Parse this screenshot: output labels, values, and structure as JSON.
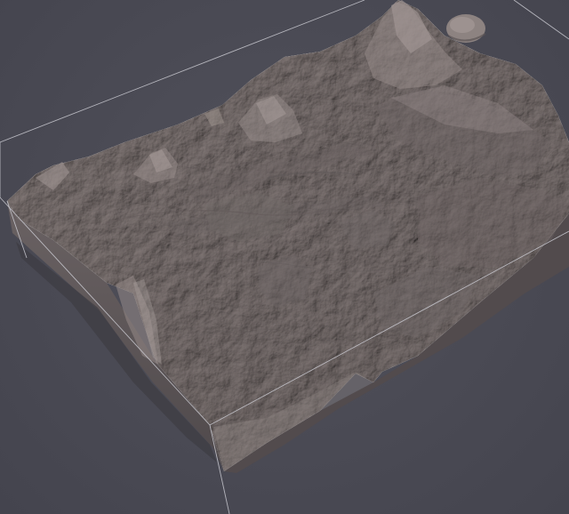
{
  "viewport": {
    "background_color": "#4a4a54"
  },
  "terrain": {
    "surface_color": "#847a78",
    "shadow_color": "#4f4a4c",
    "highlight_color": "#a39896",
    "side_color": "#5c5556"
  },
  "bounding_box": {
    "line_color": "#c9c9d0",
    "visible": true
  }
}
